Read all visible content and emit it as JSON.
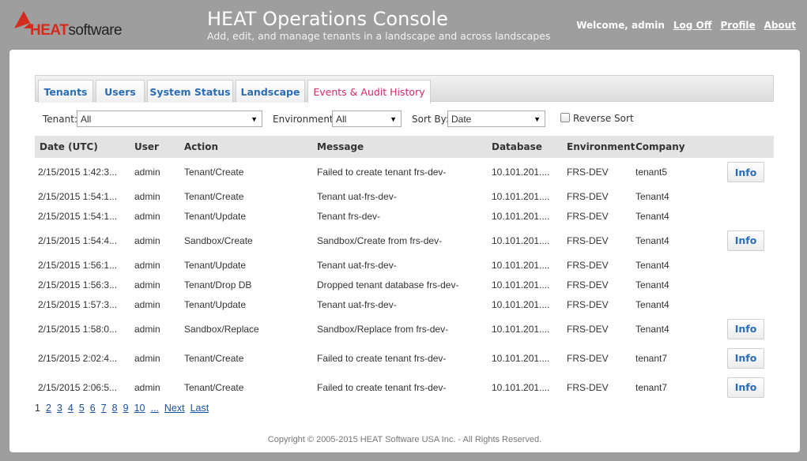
{
  "header": {
    "logo_heat": "HEAT",
    "logo_software": "software",
    "title": "HEAT Operations Console",
    "subtitle": "Add, edit, and manage tenants in a landscape and across landscapes",
    "welcome": "Welcome, admin",
    "links": [
      "Log Off",
      "Profile",
      "About"
    ]
  },
  "tabs": [
    {
      "label": "Tenants",
      "active": false
    },
    {
      "label": "Users",
      "active": false
    },
    {
      "label": "System Status",
      "active": false
    },
    {
      "label": "Landscape",
      "active": false
    },
    {
      "label": "Events & Audit History",
      "active": true
    }
  ],
  "filters": {
    "tenant_label": "Tenant:",
    "tenant_value": "All",
    "environment_label": "Environment:",
    "environment_value": "All",
    "sortby_label": "Sort By:",
    "sortby_value": "Date",
    "reverse_label": "Reverse Sort",
    "reverse_checked": false
  },
  "table": {
    "columns": [
      "Date (UTC)",
      "User",
      "Action",
      "Message",
      "Database",
      "Environment",
      "Company"
    ],
    "rows": [
      {
        "date": "2/15/2015 1:42:3...",
        "user": "admin",
        "action": "Tenant/Create",
        "message": "Failed to create tenant frs-dev-",
        "database": "10.101.201....",
        "environment": "FRS-DEV",
        "company": "tenant5",
        "info": "Info"
      },
      {
        "date": "2/15/2015 1:54:1...",
        "user": "admin",
        "action": "Tenant/Create",
        "message": "Tenant uat-frs-dev-",
        "database": "10.101.201....",
        "environment": "FRS-DEV",
        "company": "Tenant4",
        "info": ""
      },
      {
        "date": "2/15/2015 1:54:1...",
        "user": "admin",
        "action": "Tenant/Update",
        "message": "Tenant frs-dev-",
        "database": "10.101.201....",
        "environment": "FRS-DEV",
        "company": "Tenant4",
        "info": ""
      },
      {
        "date": "2/15/2015 1:54:4...",
        "user": "admin",
        "action": "Sandbox/Create",
        "message": "Sandbox/Create from frs-dev-",
        "database": "10.101.201....",
        "environment": "FRS-DEV",
        "company": "Tenant4",
        "info": "Info"
      },
      {
        "date": "2/15/2015 1:56:1...",
        "user": "admin",
        "action": "Tenant/Update",
        "message": "Tenant uat-frs-dev-",
        "database": "10.101.201....",
        "environment": "FRS-DEV",
        "company": "Tenant4",
        "info": ""
      },
      {
        "date": "2/15/2015 1:56:3...",
        "user": "admin",
        "action": "Tenant/Drop DB",
        "message": "Dropped tenant database frs-dev-",
        "database": "10.101.201....",
        "environment": "FRS-DEV",
        "company": "Tenant4",
        "info": ""
      },
      {
        "date": "2/15/2015 1:57:3...",
        "user": "admin",
        "action": "Tenant/Update",
        "message": "Tenant uat-frs-dev-",
        "database": "10.101.201....",
        "environment": "FRS-DEV",
        "company": "Tenant4",
        "info": ""
      },
      {
        "date": "2/15/2015 1:58:0...",
        "user": "admin",
        "action": "Sandbox/Replace",
        "message": "Sandbox/Replace from frs-dev-",
        "database": "10.101.201....",
        "environment": "FRS-DEV",
        "company": "Tenant4",
        "info": "Info"
      },
      {
        "date": "2/15/2015 2:02:4...",
        "user": "admin",
        "action": "Tenant/Create",
        "message": "Failed to create tenant frs-dev-",
        "database": "10.101.201....",
        "environment": "FRS-DEV",
        "company": "tenant7",
        "info": "Info"
      },
      {
        "date": "2/15/2015 2:06:5...",
        "user": "admin",
        "action": "Tenant/Create",
        "message": "Failed to create tenant frs-dev-",
        "database": "10.101.201....",
        "environment": "FRS-DEV",
        "company": "tenant7",
        "info": "Info"
      }
    ]
  },
  "pager": {
    "current": "1",
    "pages": [
      "2",
      "3",
      "4",
      "5",
      "6",
      "7",
      "8",
      "9",
      "10",
      "...",
      "Next",
      "Last"
    ]
  },
  "footer": "Copyright © 2005-2015 HEAT Software USA Inc. - All Rights Reserved.",
  "colors": {
    "background": "#9e9e9e",
    "brand_red": "#d52b1e",
    "tab_link": "#2a6db5",
    "active_tab": "#d6286a",
    "page_link": "#1a4fa6"
  }
}
